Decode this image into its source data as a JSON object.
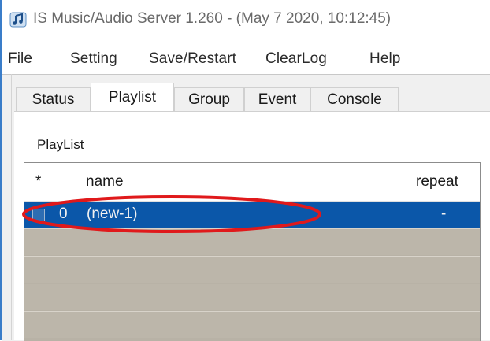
{
  "window": {
    "title": "IS Music/Audio Server 1.260 - (May  7 2020, 10:12:45)"
  },
  "menu": {
    "items": [
      "File",
      "Setting",
      "Save/Restart",
      "ClearLog",
      "Help"
    ]
  },
  "tabs": [
    "Status",
    "Playlist",
    "Group",
    "Event",
    "Console"
  ],
  "active_tab": "Playlist",
  "playlist_group": {
    "label": "PlayList"
  },
  "playlist_table": {
    "columns": [
      "*",
      "name",
      "repeat"
    ],
    "rows": [
      {
        "index": "0",
        "name": "(new-1)",
        "repeat": "-",
        "selected": true
      }
    ]
  },
  "colors": {
    "selection": "#0b57a9",
    "empty_rows": "#bcb6aa",
    "annotation": "#e0191b"
  },
  "icons": {
    "app": "music-note-icon"
  }
}
